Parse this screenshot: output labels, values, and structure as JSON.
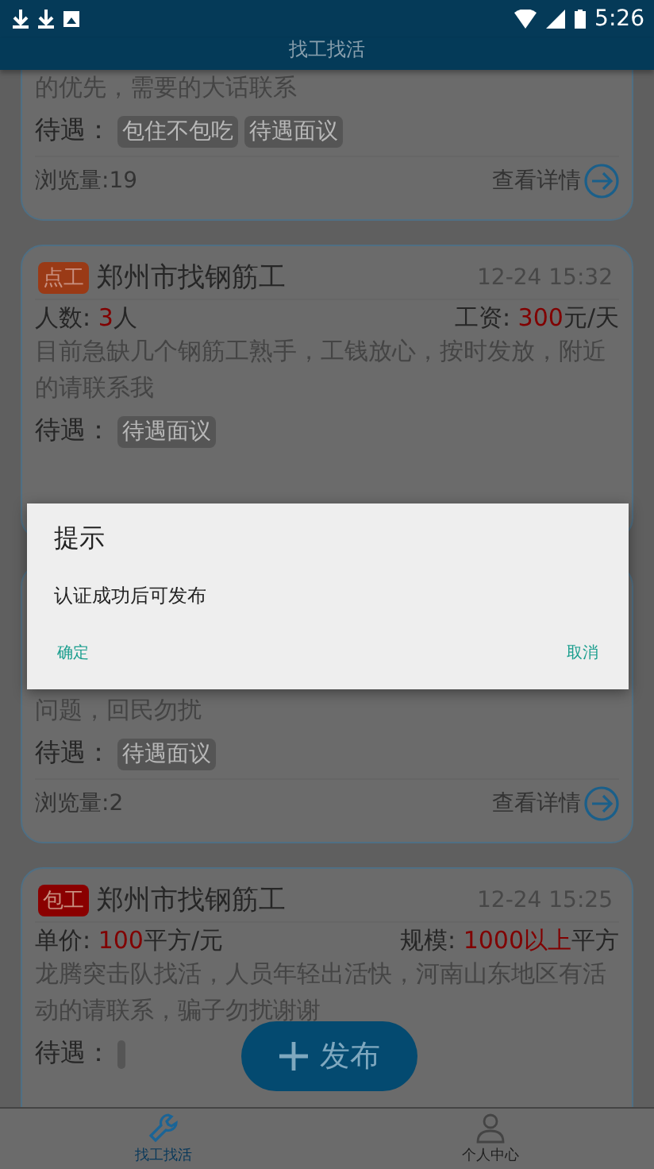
{
  "status_bar": {
    "time": "5:26"
  },
  "header": {
    "title": "找工找活"
  },
  "cards": [
    {
      "description": "的优先，需要的大话联系",
      "benefits_label": "待遇：",
      "benefits": [
        "包住不包吃",
        "待遇面议"
      ],
      "views": "浏览量:19",
      "detail": "查看详情"
    },
    {
      "tag": {
        "text": "点工",
        "color": "#9a3a16"
      },
      "title": "郑州市找钢筋工",
      "time": "12-24 15:32",
      "left": {
        "label": "人数: ",
        "value": "3",
        "unit": "人"
      },
      "right": {
        "label": "工资: ",
        "value": "300",
        "unit": "元/天"
      },
      "description": "目前急缺几个钢筋工熟手，工钱放心，按时发放，附近的请联系我",
      "benefits_label": "待遇：",
      "benefits": [
        "待遇面议"
      ]
    },
    {
      "description": "问题，回民勿扰",
      "benefits_label": "待遇：",
      "benefits": [
        "待遇面议"
      ],
      "views": "浏览量:2",
      "detail": "查看详情"
    },
    {
      "tag": {
        "text": "包工",
        "color": "#8a0000"
      },
      "title": "郑州市找钢筋工",
      "time": "12-24 15:25",
      "left": {
        "label": "单价: ",
        "value": "100",
        "unit": "平方/元"
      },
      "right": {
        "label": "规模: ",
        "value": "1000以上",
        "unit": "平方"
      },
      "description": "龙腾突击队找活，人员年轻出活快，河南山东地区有活动的请联系，骗子勿扰谢谢",
      "benefits_label": "待遇：",
      "blank_benefit": true
    }
  ],
  "fab": {
    "label": "发布"
  },
  "dialog": {
    "title": "提示",
    "message": "认证成功后可发布",
    "buttons": [
      "确定",
      "取消"
    ]
  },
  "bottom_nav": [
    {
      "label": "找工找活",
      "selected": true
    },
    {
      "label": "个人中心",
      "selected": false
    }
  ]
}
